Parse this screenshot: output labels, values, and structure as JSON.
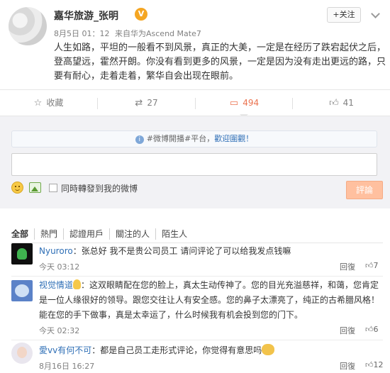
{
  "post": {
    "author": "嘉华旅游_张明",
    "verified_badge": "V",
    "time": "8月5日 01：12",
    "source": "来自华为Ascend Mate7",
    "follow_label": "+关注",
    "text": "人生如路，平坦的一般看不到风景，真正的大美，一定是在经历了跌宕起伏之后，登高望远，霍然开朗。你没有看到更多的风景，一定是因为没有走出更远的路，只要有耐心，走着走着，繁华自会出现在眼前。"
  },
  "actions": {
    "favorite": "收藏",
    "repost_count": "27",
    "comment_count": "494",
    "like_count": "41",
    "accent": "#eb7350"
  },
  "composer": {
    "promo_prefix": "#微博開播#平台，",
    "promo_link": "歡迎圍觀！",
    "repost_checkbox_label": "同時轉發到我的微博",
    "submit_label": "評論"
  },
  "tabs": [
    "全部",
    "熱門",
    "認證用戶",
    "關注的人",
    "陌生人"
  ],
  "comments": [
    {
      "name": "Nyuroro",
      "text": "：张总好 我不是贵公司员工 请问评论了可以给我发点钱嘛",
      "time": "今天 03:12",
      "reply": "回復",
      "likes": "7"
    },
    {
      "name": "视觉情道",
      "text": "：这双眼睛配在您的脸上，真太生动传神了。您的目光充溢慈祥，和蔼，您肯定是一位人缘很好的领导。跟您交往让人有安全感。您的鼻子太漂亮了，纯正的古希腊风格！ 能在您的手下做事，真是太幸运了，什么时候我有机会投到您的门下。",
      "time": "今天 02:32",
      "reply": "回復",
      "likes": "6"
    },
    {
      "name": "愛vv有何不可",
      "text": "：都是自己员工走形式评论，你觉得有意思吗",
      "time": "8月16日 16:27",
      "reply": "回復",
      "likes": "12"
    }
  ]
}
